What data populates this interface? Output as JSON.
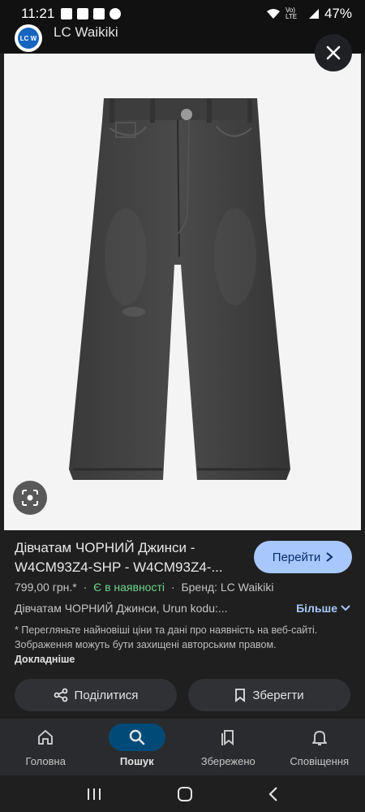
{
  "status": {
    "time": "11:21",
    "battery": "47%",
    "network": "Vo) LTE"
  },
  "header": {
    "logo_text": "LC W",
    "site_name": "LC Waikiki"
  },
  "product": {
    "title": "Дівчатам ЧОРНИЙ Джинси - W4CM93Z4-SHP - W4CM93Z4-...",
    "visit_label": "Перейти",
    "price": "799,00 грн.*",
    "separator": "·",
    "stock": "Є в наявності",
    "brand": "Бренд: LC Waikiki",
    "description": "Дівчатам ЧОРНИЙ Джинси, Urun kodu:...",
    "more_label": "Більше",
    "disclaimer": "* Перегляньте найновіші ціни та дані про наявність на веб-сайті. Зображення можуть бути захищені авторським правом.",
    "disclaimer_link": "Докладніше",
    "share_label": "Поділитися",
    "save_label": "Зберегти"
  },
  "bottom_nav": {
    "items": [
      {
        "label": "Головна",
        "icon": "home-icon"
      },
      {
        "label": "Пошук",
        "icon": "search-icon"
      },
      {
        "label": "Збережено",
        "icon": "bookmarks-icon"
      },
      {
        "label": "Сповіщення",
        "icon": "bell-icon"
      }
    ],
    "active_index": 1
  },
  "colors": {
    "accent": "#a8c7fa",
    "in_stock": "#6dd58c",
    "nav_active": "#004a77"
  }
}
